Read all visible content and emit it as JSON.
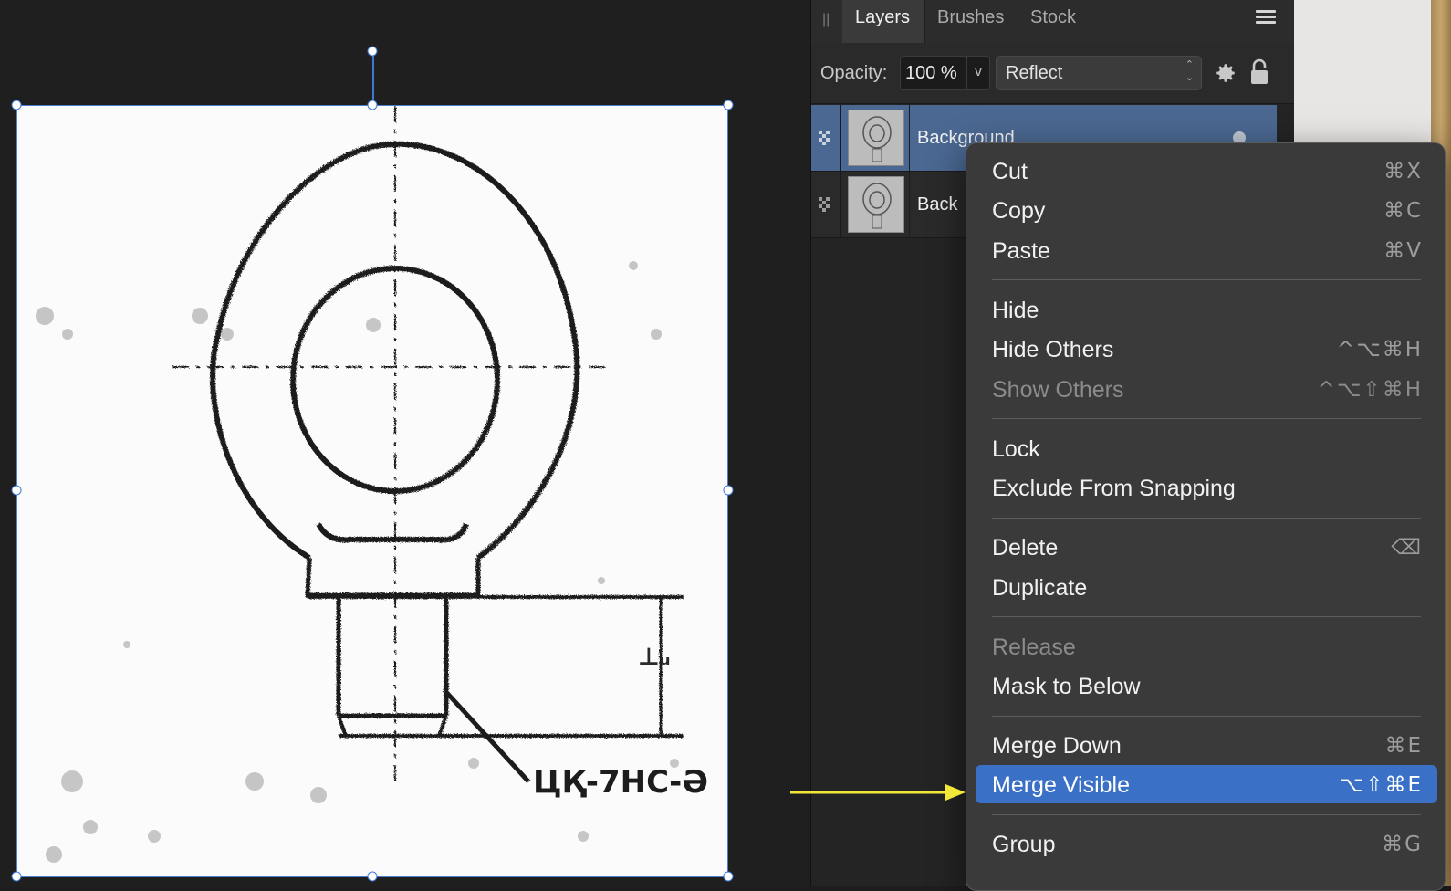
{
  "panel": {
    "tabs": [
      {
        "label": "Layers",
        "active": true
      },
      {
        "label": "Brushes",
        "active": false
      },
      {
        "label": "Stock",
        "active": false
      }
    ],
    "opacity_label": "Opacity:",
    "opacity_value": "100 %",
    "opacity_dropdown_glyph": "v",
    "blend_mode": "Reflect",
    "layers": [
      {
        "name": "Background",
        "selected": true
      },
      {
        "name": "Back",
        "selected": false
      }
    ]
  },
  "image": {
    "drawing_text": "ЦҚ-7НС-Ә"
  },
  "context_menu": {
    "items": [
      {
        "label": "Cut",
        "shortcut": "⌘X",
        "disabled": false,
        "highlight": false
      },
      {
        "label": "Copy",
        "shortcut": "⌘C",
        "disabled": false,
        "highlight": false
      },
      {
        "label": "Paste",
        "shortcut": "⌘V",
        "disabled": false,
        "highlight": false
      },
      {
        "label": "Hide",
        "shortcut": "",
        "disabled": false,
        "highlight": false
      },
      {
        "label": "Hide Others",
        "shortcut": "^⌥⌘H",
        "disabled": false,
        "highlight": false
      },
      {
        "label": "Show Others",
        "shortcut": "^⌥⇧⌘H",
        "disabled": true,
        "highlight": false
      },
      {
        "label": "Lock",
        "shortcut": "",
        "disabled": false,
        "highlight": false
      },
      {
        "label": "Exclude From Snapping",
        "shortcut": "",
        "disabled": false,
        "highlight": false
      },
      {
        "label": "Delete",
        "shortcut": "⌫",
        "disabled": false,
        "highlight": false
      },
      {
        "label": "Duplicate",
        "shortcut": "",
        "disabled": false,
        "highlight": false
      },
      {
        "label": "Release",
        "shortcut": "",
        "disabled": true,
        "highlight": false
      },
      {
        "label": "Mask to Below",
        "shortcut": "",
        "disabled": false,
        "highlight": false
      },
      {
        "label": "Merge Down",
        "shortcut": "⌘E",
        "disabled": false,
        "highlight": false
      },
      {
        "label": "Merge Visible",
        "shortcut": "⌥⇧⌘E",
        "disabled": false,
        "highlight": true
      },
      {
        "label": "Group",
        "shortcut": "⌘G",
        "disabled": false,
        "highlight": false
      }
    ]
  },
  "colors": {
    "selection_blue": "#3d78d8",
    "menu_highlight": "#3a70c6",
    "annotation_arrow": "#f3e73a",
    "selected_layer": "#4b6892"
  }
}
